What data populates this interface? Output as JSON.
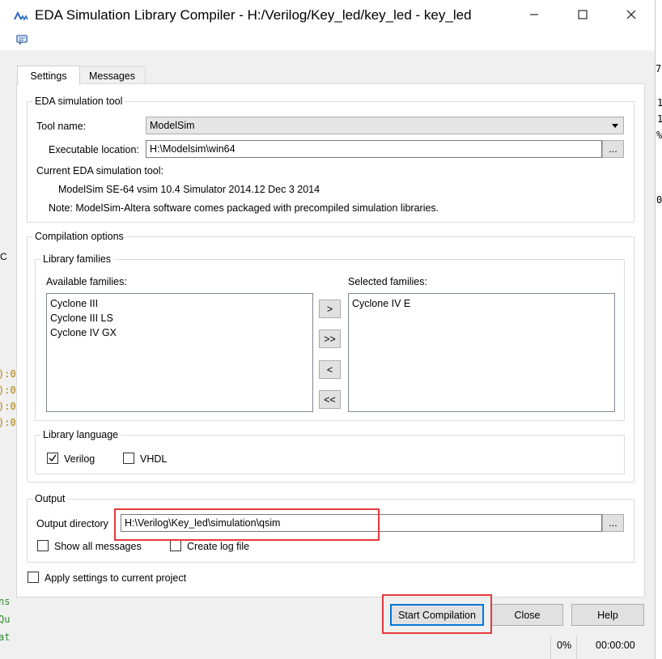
{
  "window": {
    "title": "EDA Simulation Library Compiler - H:/Verilog/Key_led/key_led - key_led",
    "minimize_label": "—",
    "maximize_label": "☐",
    "close_label": "✕"
  },
  "tabs": [
    {
      "label": "Settings",
      "active": true
    },
    {
      "label": "Messages",
      "active": false
    }
  ],
  "eda_tool": {
    "legend": "EDA simulation tool",
    "tool_name_label": "Tool name:",
    "tool_name_value": "ModelSim",
    "exe_location_label": "Executable location:",
    "exe_location_value": "H:\\Modelsim\\win64",
    "browse_label": "...",
    "current_tool_label": "Current EDA simulation tool:",
    "current_tool_value": "ModelSim SE-64 vsim 10.4 Simulator 2014.12 Dec  3 2014",
    "note": "Note: ModelSim-Altera software comes packaged with precompiled simulation libraries."
  },
  "compilation": {
    "legend": "Compilation options",
    "library_families_legend": "Library families",
    "available_label": "Available families:",
    "available": [
      "Cyclone III",
      "Cyclone III LS",
      "Cyclone IV GX"
    ],
    "selected_label": "Selected families:",
    "selected": [
      "Cyclone IV E"
    ],
    "buttons": {
      "add": ">",
      "add_all": ">>",
      "remove": "<",
      "remove_all": "<<"
    },
    "language_legend": "Library language",
    "verilog_label": "Verilog",
    "verilog_checked": true,
    "vhdl_label": "VHDL",
    "vhdl_checked": false
  },
  "output": {
    "legend": "Output",
    "dir_label": "Output directory",
    "dir_value": "H:\\Verilog\\Key_led\\simulation\\qsim",
    "browse_label": "...",
    "show_all_label": "Show all messages",
    "show_all_checked": false,
    "create_log_label": "Create log file",
    "create_log_checked": false
  },
  "apply_label": "Apply settings to current project",
  "apply_checked": false,
  "footer_buttons": {
    "start": "Start Compilation",
    "close": "Close",
    "help": "Help"
  },
  "status": {
    "progress": "0%",
    "elapsed": "00:00:00"
  },
  "background": {
    "right_fragments": [
      "7",
      "1",
      "1",
      "%",
      "0"
    ],
    "left_fragments": [
      "C",
      "):0",
      "):0",
      "):0",
      "):0",
      "ns",
      "Qu",
      "at"
    ]
  },
  "colors": {
    "highlight": "#e8393c",
    "window_bg": "#f0f0f0",
    "bg_text_yellow": "#b08000",
    "bg_text_green": "#2e8b2e"
  }
}
